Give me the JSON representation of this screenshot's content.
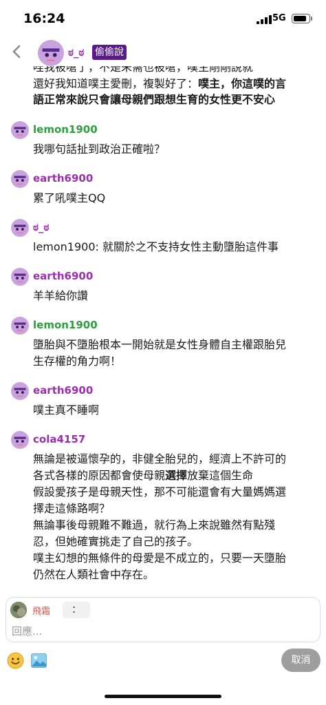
{
  "status_bar": {
    "time": "16:24",
    "network": "5G",
    "battery_level": 0.9
  },
  "header": {
    "name": "ಠ_ಠ",
    "badge": "偷偷說"
  },
  "colors": {
    "purple_user": "#9b2fae",
    "green_user": "#2e9e3e",
    "badge_bg": "#5a1a8c",
    "composer_name": "#d9534f",
    "cancel_bg": "#9e9e9e"
  },
  "partial_top": {
    "line1": "哇我被嗆了，不是朱需也被嗆，噗主剛剛說就",
    "line2_plain": "還好我知道噗主愛刪，複製好了：",
    "line2_bold": "噗主，你這噗的言",
    "line3_bold": "語正常來說只會讓母親們跟想生育的女性更不安心"
  },
  "messages": [
    {
      "user": "lemon1900",
      "color": "green",
      "text": "我哪句話扯到政治正確啦？"
    },
    {
      "user": "earth6900",
      "color": "purple",
      "text": "累了吼噗主QQ"
    },
    {
      "user": "ಠ_ಠ",
      "color": "purple",
      "text": "lemon1900: 就關於之不支持女性主動墮胎這件事"
    },
    {
      "user": "earth6900",
      "color": "purple",
      "text": "羊羊給你讚"
    },
    {
      "user": "lemon1900",
      "color": "green",
      "line1": "墮胎與不墮胎根本一開始就是女性身體自主權跟胎兒",
      "line2": "生存權的角力啊！"
    },
    {
      "user": "earth6900",
      "color": "purple",
      "text": "噗主真不睡啊"
    },
    {
      "user": "cola4157",
      "color": "purple",
      "lines": [
        "無論是被逼懷孕的，非健全胎兒的，經濟上不許可的",
        "各式各樣的原因都會使母親",
        "選擇",
        "放棄這個生命",
        "假設愛孩子是母親天性，那不可能還會有大量媽媽選",
        "擇走這條路啊？",
        "無論事後母親難不難過，就行為上來說雖然有點殘",
        "忍，但她確實挑走了自己的孩子。",
        "噗主幻想的無條件的母愛是不成立的，只要一天墮胎",
        "仍然在人類社會中存在。"
      ]
    }
  ],
  "composer": {
    "name": "飛霜",
    "colon": "：",
    "placeholder": "回應..."
  },
  "actions": {
    "cancel": "取消"
  }
}
